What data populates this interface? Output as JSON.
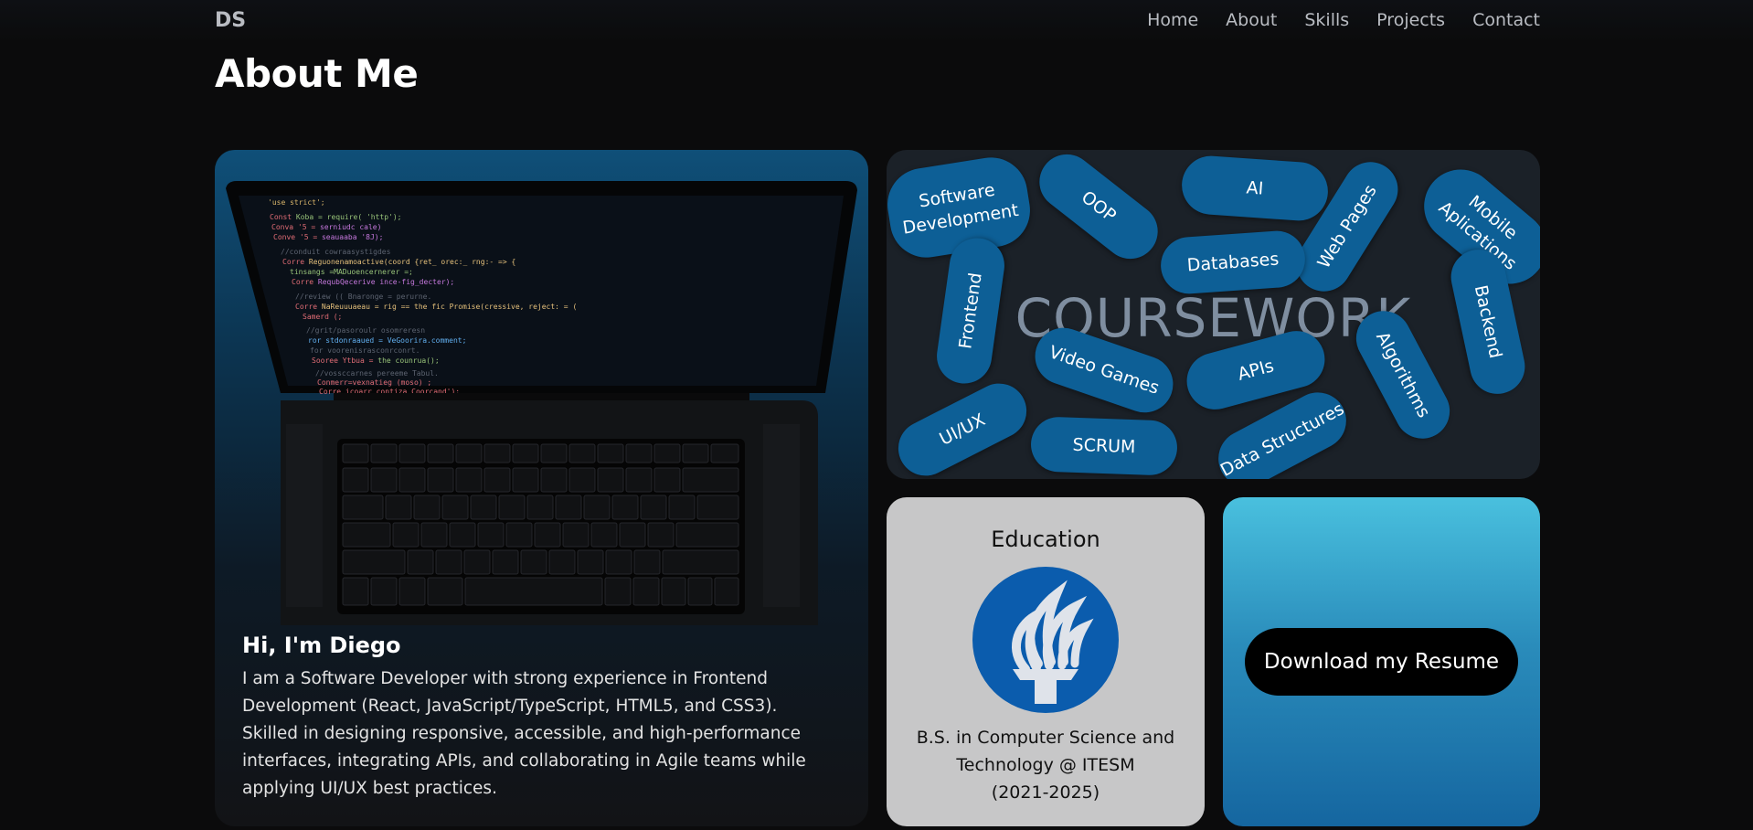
{
  "nav": {
    "logo": "DS",
    "links": [
      "Home",
      "About",
      "Skills",
      "Projects",
      "Contact"
    ]
  },
  "page_title": "About Me",
  "profile": {
    "name": "Hi, I'm Diego",
    "bio": "I am a Software Developer with strong experience in Frontend Development (React, JavaScript/TypeScript, HTML5, and CSS3). Skilled in designing responsive, accessible, and high-performance interfaces, integrating APIs, and collaborating in Agile teams while applying UI/UX best practices.",
    "image_icon": "laptop-code-image"
  },
  "coursework": {
    "title": "COURSEWORK",
    "topics": [
      "Software Development",
      "OOP",
      "AI",
      "Web Pages",
      "Mobile Aplications",
      "Databases",
      "Frontend",
      "Backend",
      "Video Games",
      "APIs",
      "Algorithms",
      "UI/UX",
      "SCRUM",
      "Data Structures"
    ]
  },
  "education": {
    "title": "Education",
    "logo_icon": "itesm-torch-logo",
    "degree_line1": "B.S. in Computer Science and",
    "degree_line2": "Technology @ ITESM",
    "years": "(2021-2025)"
  },
  "resume": {
    "button_label": "Download my Resume"
  },
  "colors": {
    "background": "#0b0b0c",
    "pill": "#0d5f96",
    "education_card": "#c7c7c8",
    "resume_gradient_top": "#49c0de",
    "resume_gradient_bottom": "#1566a0",
    "itesm_blue": "#0b5cad"
  }
}
